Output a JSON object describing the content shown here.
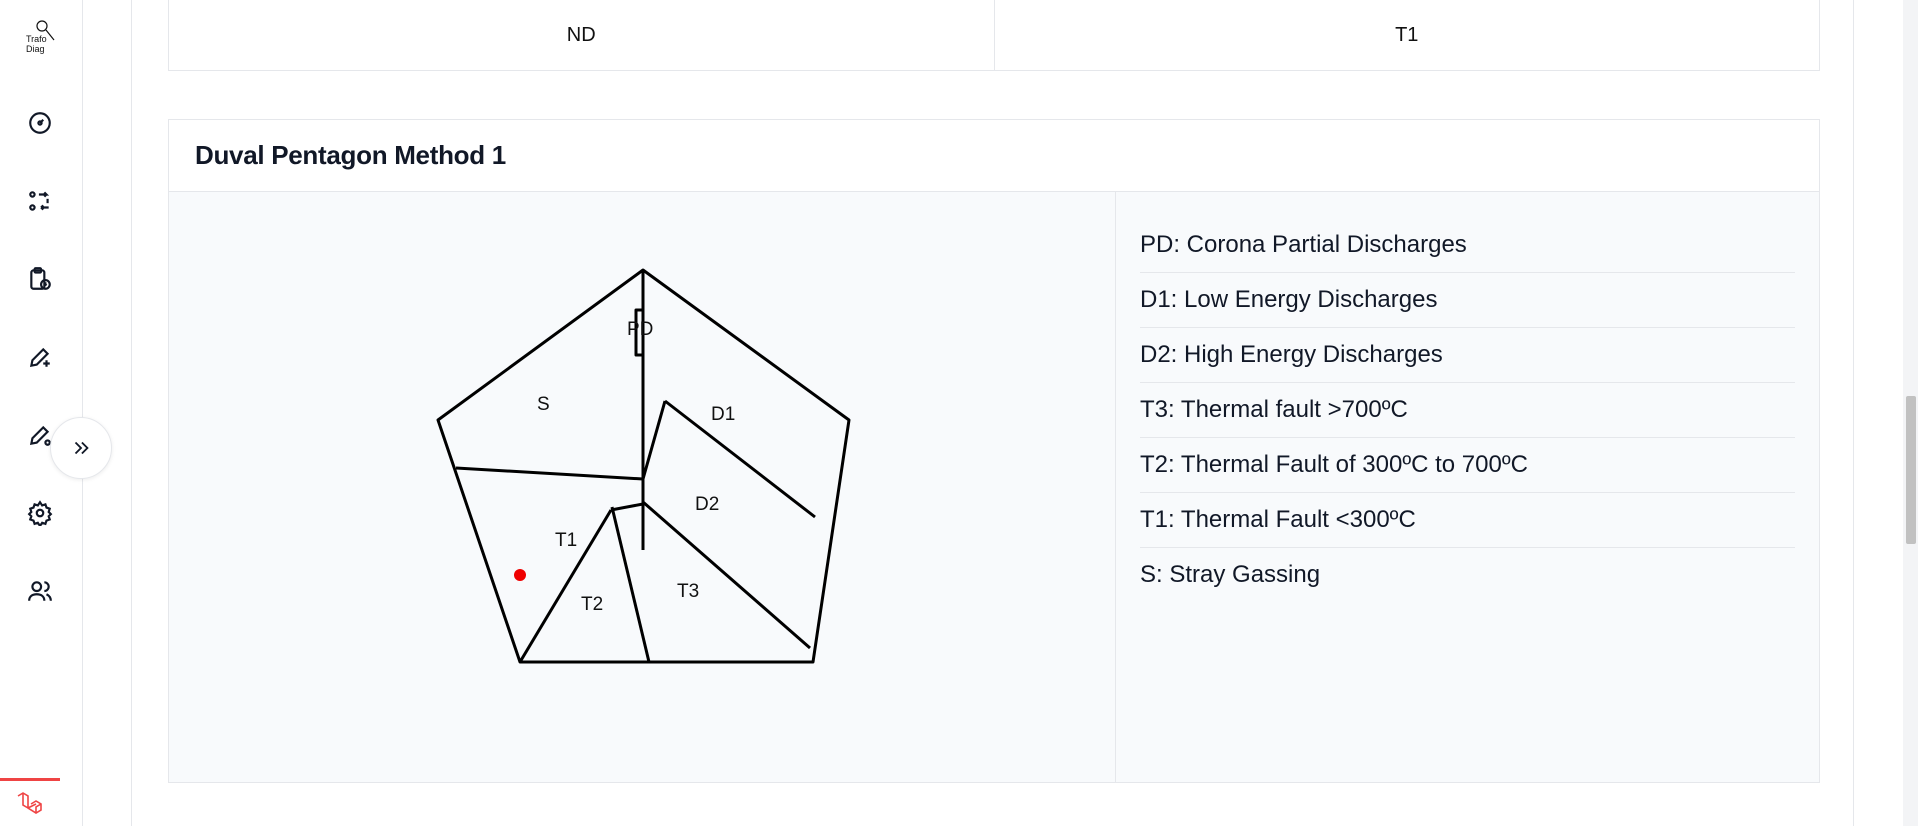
{
  "app": {
    "logo_text": "Trafo Diag"
  },
  "sidebar": {
    "items": [
      {
        "icon": "gauge-icon"
      },
      {
        "icon": "transfer-icon"
      },
      {
        "icon": "clipboard-clock-icon"
      },
      {
        "icon": "pen-plus-icon"
      },
      {
        "icon": "pen-settings-icon"
      },
      {
        "icon": "gear-icon"
      },
      {
        "icon": "users-icon"
      }
    ]
  },
  "result_row": {
    "left": "ND",
    "right": "T1"
  },
  "card": {
    "title": "Duval Pentagon Method 1"
  },
  "pentagon": {
    "regions": [
      "PD",
      "S",
      "D1",
      "D2",
      "T1",
      "T2",
      "T3"
    ],
    "point_color": "#ef0000"
  },
  "legend": [
    "PD: Corona Partial Discharges",
    "D1: Low Energy Discharges",
    "D2: High Energy Discharges",
    "T3: Thermal fault >700ºC",
    "T2: Thermal Fault of 300ºC to 700ºC",
    "T1: Thermal Fault <300ºC",
    "S: Stray Gassing"
  ]
}
